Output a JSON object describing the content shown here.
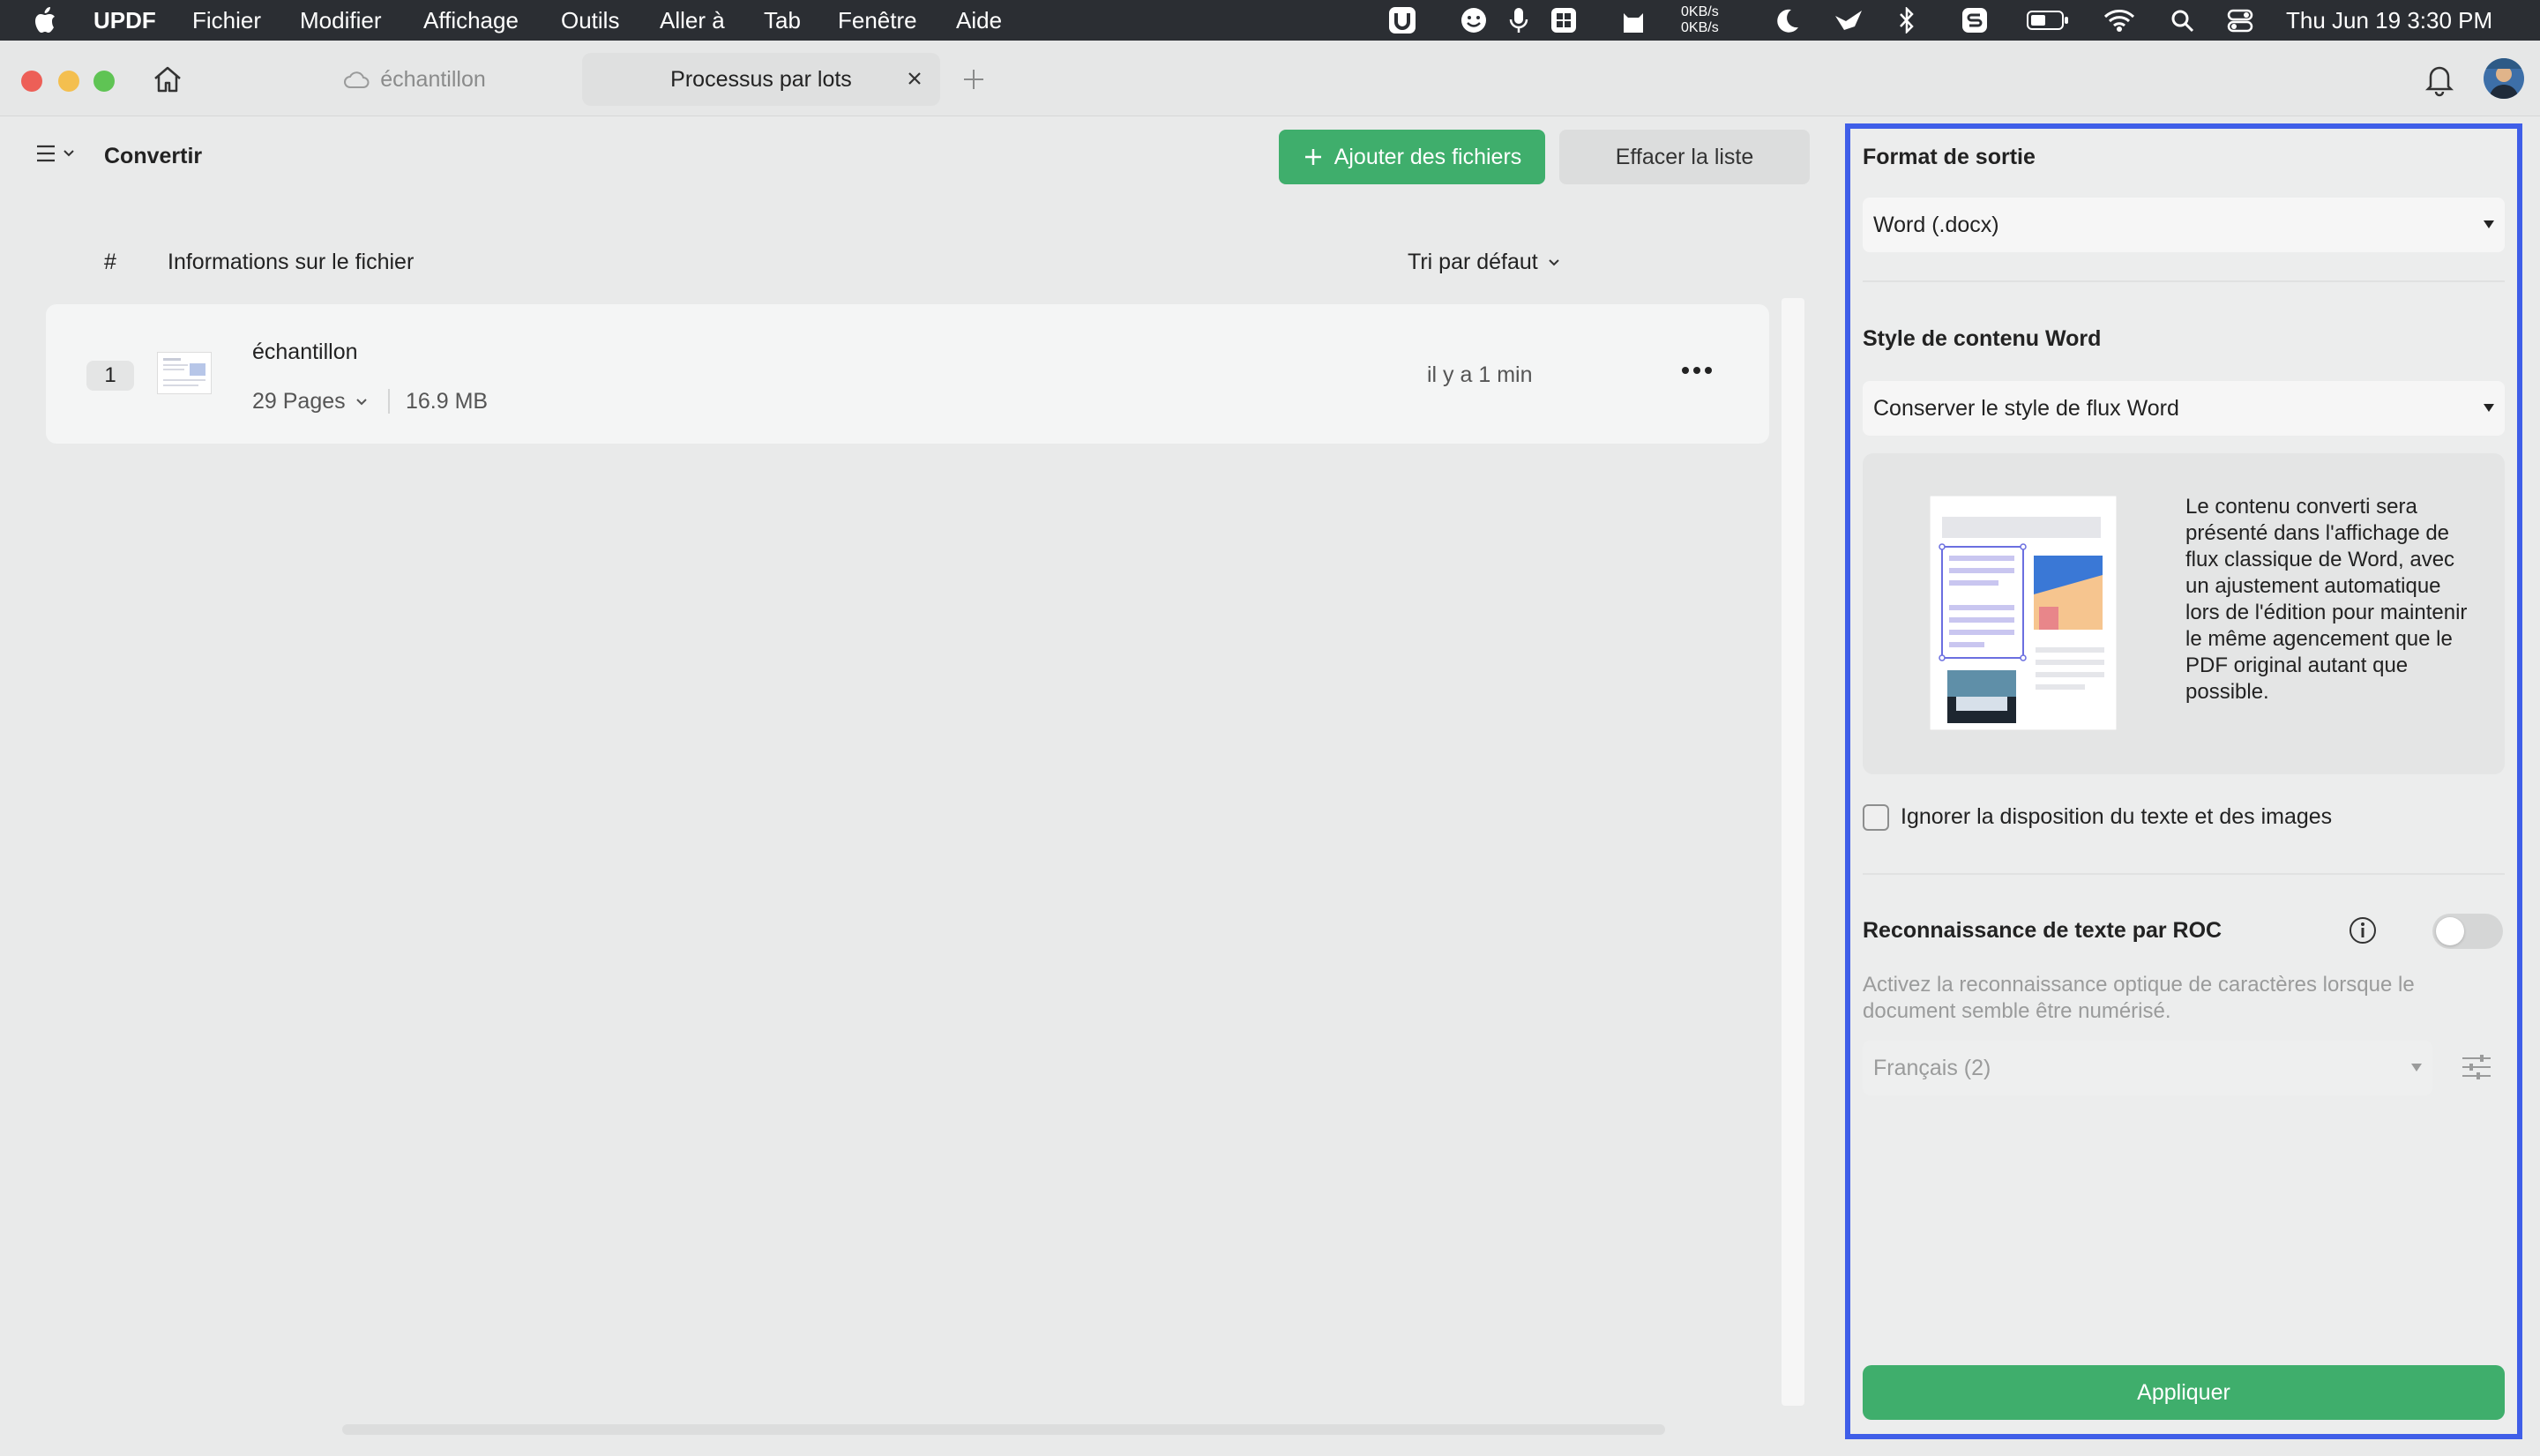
{
  "menubar": {
    "app": "UPDF",
    "items": [
      "Fichier",
      "Modifier",
      "Affichage",
      "Outils",
      "Aller à",
      "Tab",
      "Fenêtre",
      "Aide"
    ],
    "netspeed_up": "0KB/s",
    "netspeed_down": "0KB/s",
    "clock": "Thu Jun 19  3:30 PM"
  },
  "tabs": {
    "doc_tab": "échantillon",
    "active_tab": "Processus par lots"
  },
  "toolbar": {
    "mode": "Convertir",
    "add_files": "Ajouter des fichiers",
    "clear_list": "Effacer la liste"
  },
  "table": {
    "col_index": "#",
    "col_info": "Informations sur le fichier",
    "sort": "Tri par défaut",
    "rows": [
      {
        "index": "1",
        "name": "échantillon",
        "pages": "29 Pages",
        "size": "16.9 MB",
        "time": "il y a 1 min"
      }
    ]
  },
  "settings": {
    "output_format_label": "Format de sortie",
    "output_format_value": "Word (.docx)",
    "content_style_label": "Style de contenu Word",
    "content_style_value": "Conserver le style de flux Word",
    "style_description": "Le contenu converti sera présenté dans l'affichage de flux classique de Word, avec un ajustement automatique lors de l'édition pour maintenir le même agencement que le PDF original autant que possible.",
    "ignore_layout_label": "Ignorer la disposition du texte et des images",
    "ignore_layout_checked": false,
    "ocr_label": "Reconnaissance de texte par ROC",
    "ocr_enabled": false,
    "ocr_hint": "Activez la reconnaissance optique de caractères lorsque le document semble être numérisé.",
    "ocr_language": "Français (2)",
    "apply": "Appliquer"
  },
  "colors": {
    "accent_green": "#3fae6c",
    "highlight_border": "#3f5ee8",
    "menubar_bg": "#2b2e33"
  }
}
